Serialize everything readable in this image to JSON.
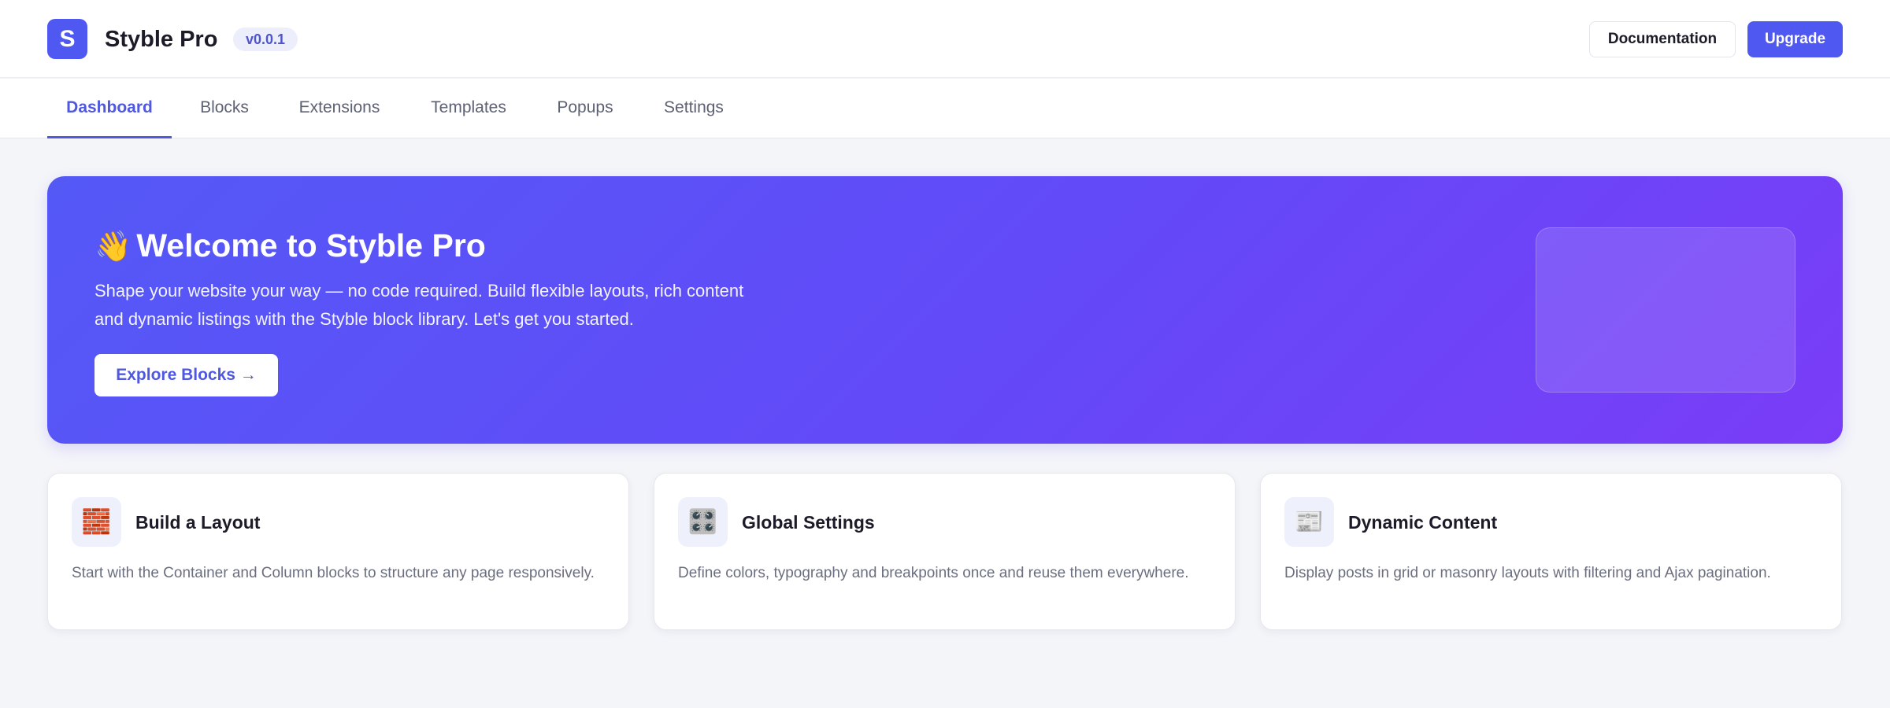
{
  "header": {
    "logo_letter": "S",
    "app_title": "Styble Pro",
    "version": "v0.0.1",
    "documentation_label": "Documentation",
    "upgrade_label": "Upgrade"
  },
  "tabs": [
    {
      "label": "Dashboard",
      "active": true
    },
    {
      "label": "Blocks"
    },
    {
      "label": "Extensions"
    },
    {
      "label": "Templates"
    },
    {
      "label": "Popups"
    },
    {
      "label": "Settings"
    }
  ],
  "hero": {
    "emoji": "👋",
    "title": "Welcome to Styble Pro",
    "text": "Shape your website your way — no code required. Build flexible layouts, rich content and dynamic listings with the Styble block library. Let's get you started.",
    "button_label": "Explore Blocks →"
  },
  "cards": [
    {
      "icon": "🧱",
      "icon_name": "bricks-icon",
      "title": "Build a Layout",
      "description": "Start with the Container and Column blocks to structure any page responsively."
    },
    {
      "icon": "🎛️",
      "icon_name": "control-knobs-icon",
      "title": "Global Settings",
      "description": "Define colors, typography and breakpoints once and reuse them everywhere."
    },
    {
      "icon": "📰",
      "icon_name": "newspaper-icon",
      "title": "Dynamic Content",
      "description": "Display posts in grid or masonry layouts with filtering and Ajax pagination."
    }
  ],
  "colors": {
    "accent": "#4f58f0",
    "hero_start": "#5459f6",
    "hero_end": "#7a3df7",
    "background": "#f4f5f9"
  }
}
